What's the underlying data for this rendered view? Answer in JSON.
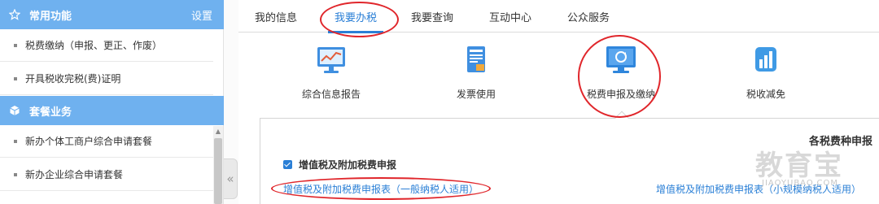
{
  "sidebar": {
    "common_section": {
      "icon": "star-outline-icon",
      "title": "常用功能",
      "action": "设置"
    },
    "common_items": [
      {
        "label": "税费缴纳（申报、更正、作废）"
      },
      {
        "label": "开具税收完税(费)证明"
      }
    ],
    "package_section": {
      "icon": "cube-icon",
      "title": "套餐业务"
    },
    "package_items": [
      {
        "label": "新办个体工商户综合申请套餐"
      },
      {
        "label": "新办企业综合申请套餐"
      }
    ]
  },
  "tabs": [
    {
      "label": "我的信息",
      "active": false
    },
    {
      "label": "我要办税",
      "active": true
    },
    {
      "label": "我要查询",
      "active": false
    },
    {
      "label": "互动中心",
      "active": false
    },
    {
      "label": "公众服务",
      "active": false
    }
  ],
  "functions": [
    {
      "label": "综合信息报告",
      "icon": "monitor-chart-icon"
    },
    {
      "label": "发票使用",
      "icon": "invoice-document-icon"
    },
    {
      "label": "税费申报及缴纳",
      "icon": "tax-declare-monitor-icon"
    },
    {
      "label": "税收减免",
      "icon": "bar-chart-icon"
    }
  ],
  "panel": {
    "title": "各税费种申报",
    "group_label": "增值税及附加税费申报",
    "links": [
      "增值税及附加税费申报表（一般纳税人适用）",
      "增值税及附加税费申报表（小规模纳税人适用）"
    ]
  },
  "watermark": {
    "text": "教育宝",
    "subtext": "JIAOYUBAO.COM"
  },
  "colors": {
    "accent": "#2a7fd6",
    "sidebar_header": "#6fb1ef",
    "annotation": "#e0262b"
  }
}
